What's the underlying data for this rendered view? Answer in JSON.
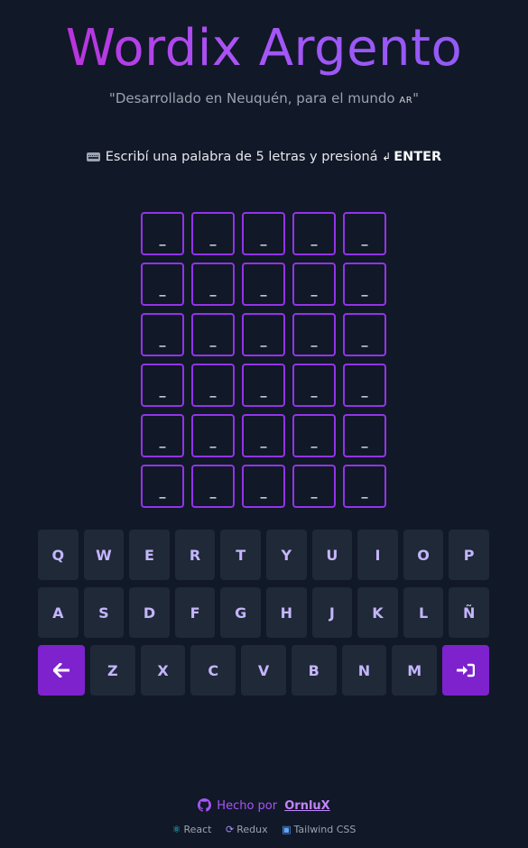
{
  "app": {
    "title": "Wordix Argento",
    "subtitle_prefix": "\"Desarrollado en Neuquén, para el mundo ",
    "subtitle_flag": "AR",
    "subtitle_suffix": "\""
  },
  "instruction": {
    "icon": "keyboard-icon",
    "text": "Escribí una palabra de 5 letras y presioná",
    "enter_icon": "↲",
    "enter_label": "ENTER"
  },
  "board": {
    "rows": 6,
    "cols": 5,
    "placeholder": "_"
  },
  "keyboard": {
    "row1": [
      "Q",
      "W",
      "E",
      "R",
      "T",
      "Y",
      "U",
      "I",
      "O",
      "P"
    ],
    "row2": [
      "A",
      "S",
      "D",
      "F",
      "G",
      "H",
      "J",
      "K",
      "L",
      "Ñ"
    ],
    "row3": [
      "Z",
      "X",
      "C",
      "V",
      "B",
      "N",
      "M"
    ],
    "backspace_icon": "arrow-left-icon",
    "enter_icon": "sign-in-icon",
    "accent_color": "#7e22ce",
    "key_color": "#1f2937"
  },
  "footer": {
    "made_by": "Hecho por",
    "author": "OrnluX",
    "tech": [
      {
        "icon": "react-icon",
        "label": "React"
      },
      {
        "icon": "redux-icon",
        "label": "Redux"
      },
      {
        "icon": "tailwind-icon",
        "label": "Tailwind CSS"
      }
    ]
  }
}
